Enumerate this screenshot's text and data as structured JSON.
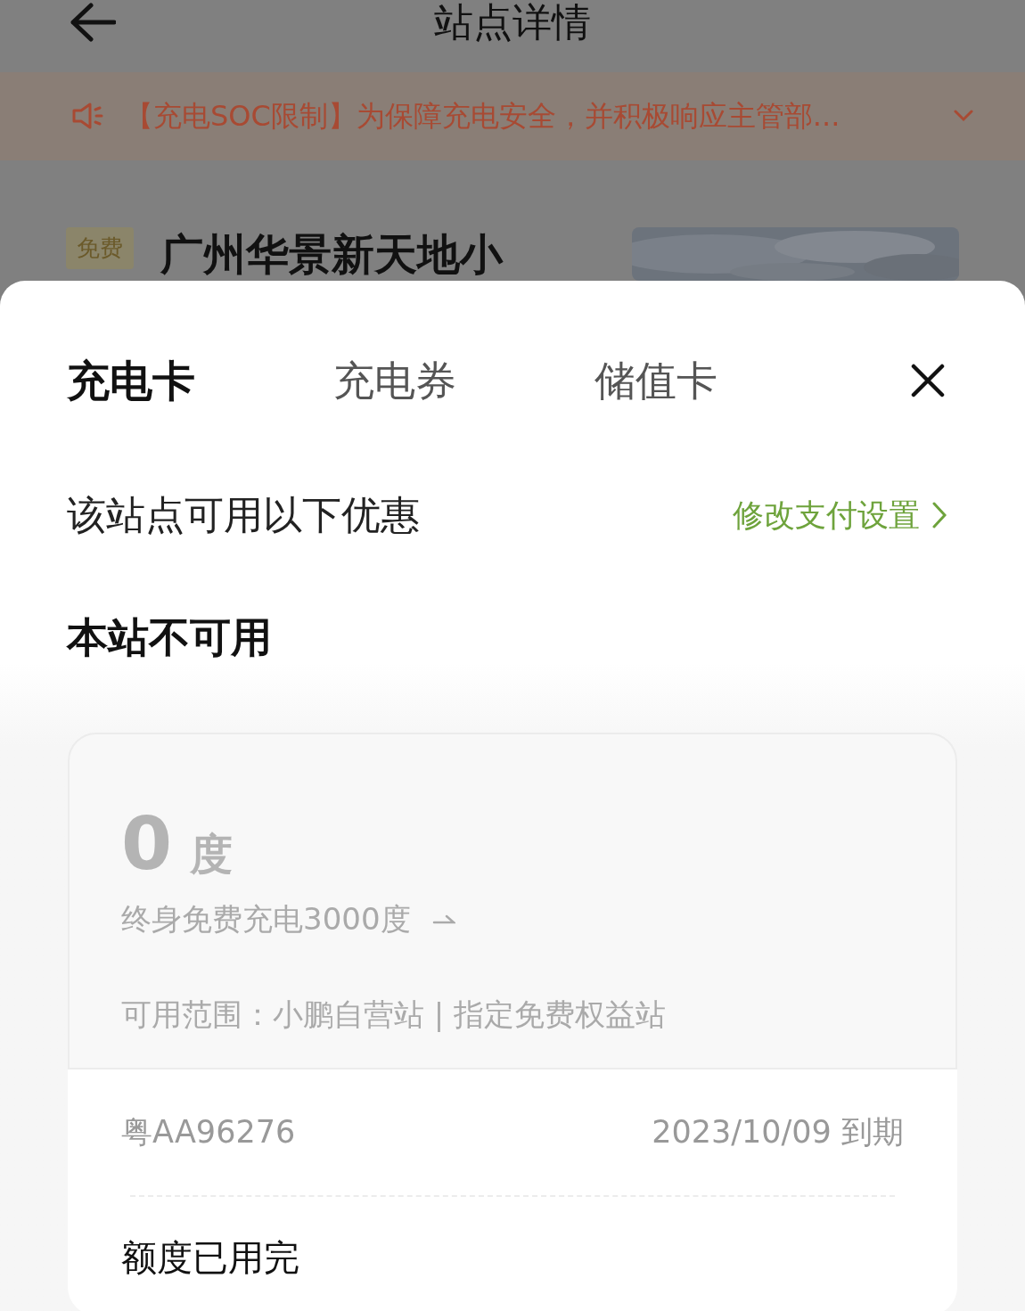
{
  "header": {
    "title": "站点详情"
  },
  "notice": {
    "text": "【充电SOC限制】为保障充电安全，并积极响应主管部..."
  },
  "station": {
    "badge": "免费",
    "name": "广州华景新天地小"
  },
  "sheet": {
    "tabs": [
      {
        "label": "充电卡",
        "selected": true
      },
      {
        "label": "充电券",
        "selected": false
      },
      {
        "label": "储值卡",
        "selected": false
      }
    ],
    "subtitle": "该站点可用以下优惠",
    "payment_link": "修改支付设置",
    "section_title": "本站不可用",
    "card": {
      "available": false,
      "amount": "0",
      "unit": "度",
      "description": "终身免费充电3000度",
      "scope": "可用范围：小鹏自营站 | 指定免费权益站",
      "plate": "粤AA96276",
      "expiry": "2023/10/09 到期",
      "status": "额度已用完"
    }
  }
}
